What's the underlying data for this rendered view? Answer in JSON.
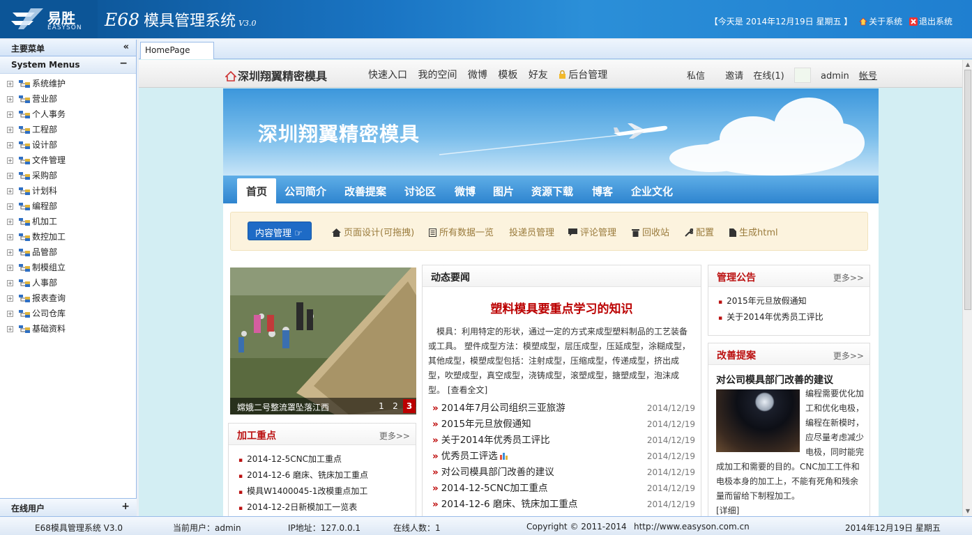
{
  "header": {
    "logo_cn": "易胜",
    "logo_en": "EASYSON",
    "title_main": "E68",
    "title_cn": "模具管理系统",
    "title_ver": "V3.0",
    "today": "【今天是 2014年12月19日 星期五 】",
    "about_link": "关于系统",
    "exit_link": "退出系统"
  },
  "sidebar": {
    "header": "主要菜单",
    "collapse_glyph": "«",
    "section": "System Menus",
    "section_btn": "−",
    "items": [
      {
        "label": "系统维护"
      },
      {
        "label": "营业部"
      },
      {
        "label": "个人事务"
      },
      {
        "label": "工程部"
      },
      {
        "label": "设计部"
      },
      {
        "label": "文件管理"
      },
      {
        "label": "采购部"
      },
      {
        "label": "计划科"
      },
      {
        "label": "编程部"
      },
      {
        "label": "机加工"
      },
      {
        "label": "数控加工"
      },
      {
        "label": "品管部"
      },
      {
        "label": "制模组立"
      },
      {
        "label": "人事部"
      },
      {
        "label": "报表查询"
      },
      {
        "label": "公司仓库"
      },
      {
        "label": "基础资料"
      }
    ],
    "footer": "在线用户",
    "footer_btn": "+"
  },
  "tabs": [
    {
      "label": "HomePage"
    }
  ],
  "topnav": {
    "brand": "深圳翔翼精密模具",
    "items": [
      {
        "label": "快速入口"
      },
      {
        "label": "我的空间"
      },
      {
        "label": "微博"
      },
      {
        "label": "模板"
      },
      {
        "label": "好友"
      },
      {
        "label": "后台管理"
      }
    ],
    "right": [
      {
        "label": "私信"
      },
      {
        "label": "邀请"
      },
      {
        "label": "在线(1)"
      }
    ],
    "user": "admin",
    "account": "帐号"
  },
  "site": {
    "banner_title": "深圳翔翼精密模具",
    "menu": [
      {
        "label": "首页"
      },
      {
        "label": "公司简介"
      },
      {
        "label": "改善提案"
      },
      {
        "label": "讨论区"
      },
      {
        "label": "微博"
      },
      {
        "label": "图片"
      },
      {
        "label": "资源下载"
      },
      {
        "label": "博客"
      },
      {
        "label": "企业文化"
      }
    ],
    "toolbar": {
      "primary": "内容管理",
      "items": [
        {
          "label": "页面设计(可拖拽)",
          "icon": "home-icon"
        },
        {
          "label": "所有数据一览",
          "icon": "list-icon"
        },
        {
          "label": "投递员管理",
          "icon": ""
        },
        {
          "label": "评论管理",
          "icon": "comment-icon"
        },
        {
          "label": "回收站",
          "icon": "trash-icon"
        },
        {
          "label": "配置",
          "icon": "wrench-icon"
        },
        {
          "label": "生成html",
          "icon": "file-icon"
        }
      ]
    },
    "slider": {
      "caption": "嫦娥二号整流罩坠落江西",
      "pages": [
        "1",
        "2",
        "3"
      ],
      "current": "3"
    },
    "processing": {
      "title": "加工重点",
      "more": "更多>>",
      "items": [
        {
          "label": "2014-12-5CNC加工重点"
        },
        {
          "label": "2014-12-6 磨床、铣床加工重点"
        },
        {
          "label": "模具W1400045-1改模重点加工"
        },
        {
          "label": "2014-12-2日新模加工一览表"
        }
      ]
    },
    "news": {
      "title": "动态要闻",
      "headline": "塑料模具要重点学习的知识",
      "body": "模具：利用特定的形状，通过一定的方式来成型塑料制品的工艺装备或工具。 塑件成型方法：模塑成型，层压成型，压延成型，涂糊成型，其他成型，模塑成型包括：注射成型，压缩成型，传递成型，挤出成型，吹塑成型，真空成型，浇铸成型，滚塑成型，搪塑成型，泡沫成型。 [查看全文]",
      "items": [
        {
          "title": "2014年7月公司组织三亚旅游",
          "date": "2014/12/19"
        },
        {
          "title": "2015年元旦放假通知",
          "date": "2014/12/19"
        },
        {
          "title": "关于2014年优秀员工评比",
          "date": "2014/12/19"
        },
        {
          "title": "优秀员工评选",
          "date": "2014/12/19"
        },
        {
          "title": "对公司模具部门改善的建议",
          "date": "2014/12/19"
        },
        {
          "title": "2014-12-5CNC加工重点",
          "date": "2014/12/19"
        },
        {
          "title": "2014-12-6 磨床、铣床加工重点",
          "date": "2014/12/19"
        }
      ]
    },
    "notice": {
      "title": "管理公告",
      "more": "更多>>",
      "items": [
        {
          "label": "2015年元旦放假通知"
        },
        {
          "label": "关于2014年优秀员工评比"
        }
      ]
    },
    "proposal": {
      "title": "改善提案",
      "more": "更多>>",
      "headline": "对公司模具部门改善的建议",
      "body": "编程需要优化加工和优化电极，编程在新模时，应尽量考虑减少电极，同时能完成加工和需要的目的。CNC加工工件和电极本身的加工上，不能有死角和残余量而留给下制程加工。",
      "detail": "[详细]"
    }
  },
  "status": {
    "app": "E68模具管理系统 V3.0",
    "user": "当前用户：admin",
    "ip": "IP地址：127.0.0.1",
    "online": "在线人数：1",
    "copyright": "Copyright © 2011-2014",
    "url": "http://www.easyson.com.cn",
    "date": "2014年12月19日 星期五"
  },
  "colors": {
    "accent": "#1a75c4",
    "alert_red": "#b11111",
    "toolbar_bg": "#fcf3de"
  }
}
